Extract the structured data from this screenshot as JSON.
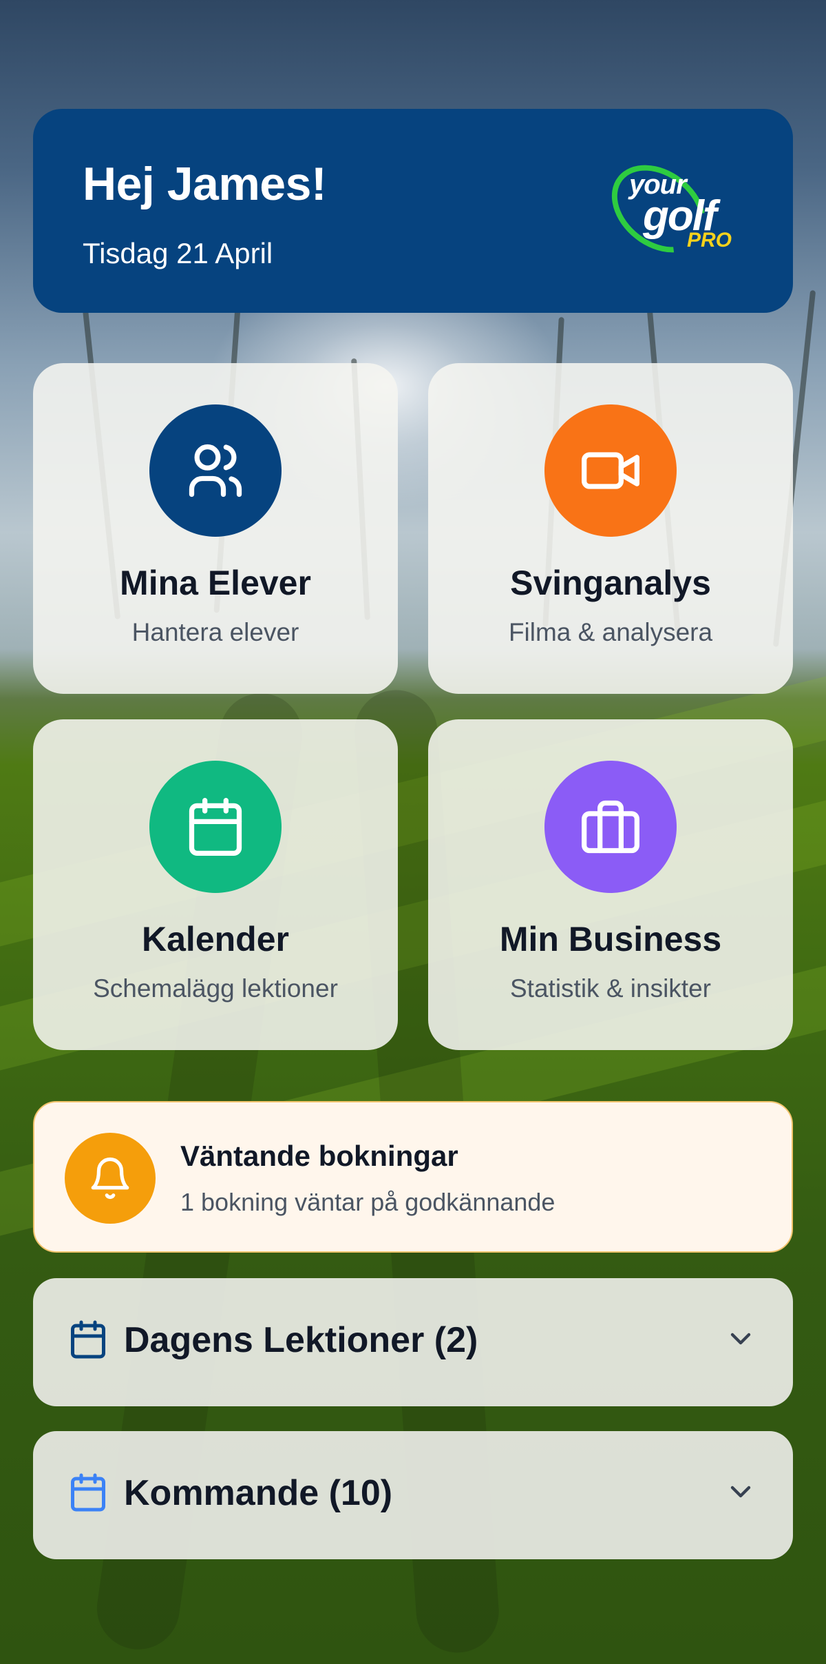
{
  "header": {
    "greeting": "Hej James!",
    "date": "Tisdag 21 April",
    "logo": {
      "your": "your",
      "golf": "golf",
      "pro": "PRO"
    }
  },
  "tiles": [
    {
      "title": "Mina Elever",
      "subtitle": "Hantera elever",
      "icon": "users-icon",
      "color": "#06437f"
    },
    {
      "title": "Svinganalys",
      "subtitle": "Filma & analysera",
      "icon": "video-camera-icon",
      "color": "#f97316"
    },
    {
      "title": "Kalender",
      "subtitle": "Schemalägg lektioner",
      "icon": "calendar-icon",
      "color": "#10b981"
    },
    {
      "title": "Min Business",
      "subtitle": "Statistik & insikter",
      "icon": "briefcase-icon",
      "color": "#8b5cf6"
    }
  ],
  "pending": {
    "title": "Väntande bokningar",
    "subtitle": "1 bokning väntar på godkännande",
    "icon": "bell-icon",
    "color": "#f59e0b"
  },
  "sections": [
    {
      "title": "Dagens Lektioner (2)",
      "icon": "calendar-icon",
      "color": "#06437f"
    },
    {
      "title": "Kommande (10)",
      "icon": "calendar-icon",
      "color": "#3b82f6"
    }
  ]
}
